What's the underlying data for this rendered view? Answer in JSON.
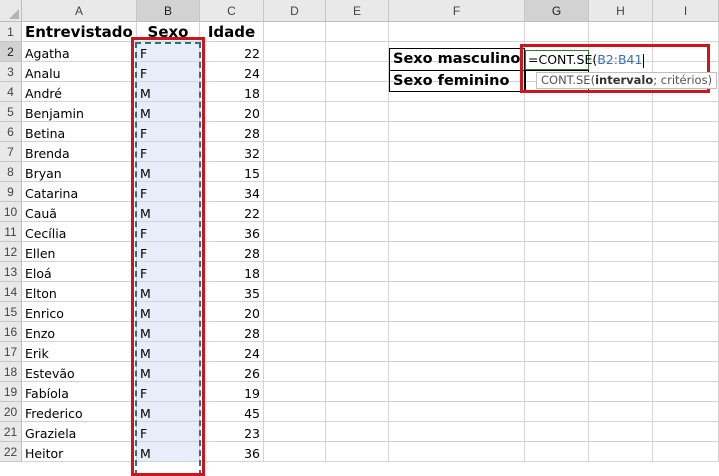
{
  "columns": [
    "A",
    "B",
    "C",
    "D",
    "E",
    "F",
    "G",
    "H",
    "I"
  ],
  "rows": [
    "1",
    "2",
    "3",
    "4",
    "5",
    "6",
    "7",
    "8",
    "9",
    "10",
    "11",
    "12",
    "13",
    "14",
    "15",
    "16",
    "17",
    "18",
    "19",
    "20",
    "21",
    "22"
  ],
  "headers": {
    "a1": "Entrevistado",
    "b1": "Sexo",
    "c1": "Idade"
  },
  "records": [
    {
      "name": "Agatha",
      "sex": "F",
      "age": "22"
    },
    {
      "name": "Analu",
      "sex": "F",
      "age": "24"
    },
    {
      "name": "André",
      "sex": "M",
      "age": "18"
    },
    {
      "name": "Benjamin",
      "sex": "M",
      "age": "20"
    },
    {
      "name": "Betina",
      "sex": "F",
      "age": "28"
    },
    {
      "name": "Brenda",
      "sex": "F",
      "age": "32"
    },
    {
      "name": "Bryan",
      "sex": "M",
      "age": "15"
    },
    {
      "name": "Catarina",
      "sex": "F",
      "age": "34"
    },
    {
      "name": "Cauã",
      "sex": "M",
      "age": "22"
    },
    {
      "name": "Cecília",
      "sex": "F",
      "age": "36"
    },
    {
      "name": "Ellen",
      "sex": "F",
      "age": "28"
    },
    {
      "name": "Eloá",
      "sex": "F",
      "age": "18"
    },
    {
      "name": "Elton",
      "sex": "M",
      "age": "35"
    },
    {
      "name": "Enrico",
      "sex": "M",
      "age": "20"
    },
    {
      "name": "Enzo",
      "sex": "M",
      "age": "28"
    },
    {
      "name": "Erik",
      "sex": "M",
      "age": "24"
    },
    {
      "name": "Estevão",
      "sex": "M",
      "age": "26"
    },
    {
      "name": "Fabíola",
      "sex": "F",
      "age": "19"
    },
    {
      "name": "Frederico",
      "sex": "M",
      "age": "45"
    },
    {
      "name": "Graziela",
      "sex": "F",
      "age": "23"
    },
    {
      "name": "Heitor",
      "sex": "M",
      "age": "36"
    }
  ],
  "summary": {
    "male_label": "Sexo masculino",
    "female_label": "Sexo feminino"
  },
  "formula": {
    "prefix": "=CONT.SE(",
    "range": "B2:B41"
  },
  "tooltip": {
    "func": "CONT.SE(",
    "arg1": "intervalo",
    "rest": "; critérios)"
  }
}
